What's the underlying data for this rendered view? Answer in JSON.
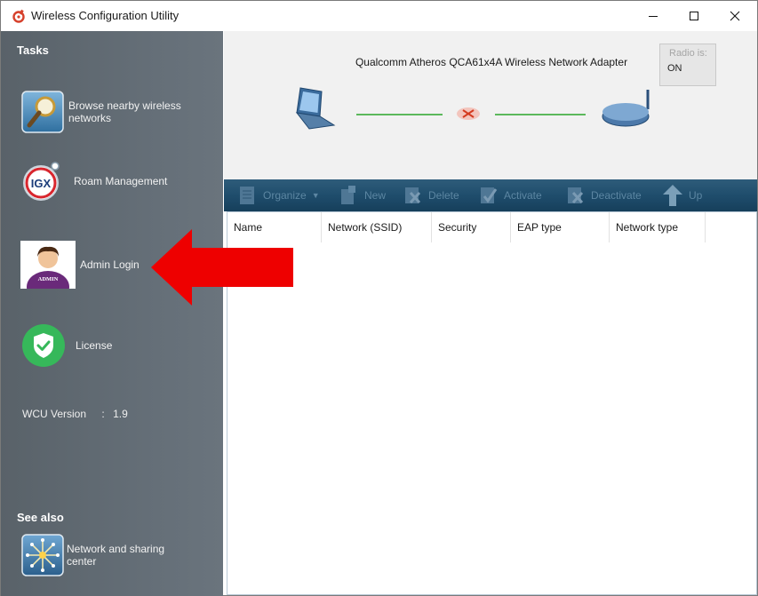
{
  "window": {
    "title": "Wireless Configuration Utility"
  },
  "sidebar": {
    "tasks_heading": "Tasks",
    "tasks": [
      {
        "label_line1": "Browse nearby wireless",
        "label_line2": "networks",
        "icon": "magnifier-icon"
      },
      {
        "label_line1": "Roam Management",
        "label_line2": "",
        "icon": "igx-logo-icon"
      },
      {
        "label_line1": "Admin Login",
        "label_line2": "",
        "icon": "admin-avatar-icon",
        "avatar_badge": "ADMIN"
      },
      {
        "label_line1": "License",
        "label_line2": "",
        "icon": "shield-check-icon"
      }
    ],
    "version_label": "WCU Version",
    "version_sep": ":",
    "version_value": "1.9",
    "see_also_heading": "See also",
    "see_also": [
      {
        "label_line1": "Network and sharing",
        "label_line2": "center",
        "icon": "network-hub-icon"
      }
    ],
    "igx_text": "IGX"
  },
  "banner": {
    "adapter_name": "Qualcomm Atheros QCA61x4A Wireless Network Adapter",
    "radio_label": "Radio is:",
    "radio_value": "ON"
  },
  "toolbar": {
    "organize": "Organize",
    "new": "New",
    "delete": "Delete",
    "activate": "Activate",
    "deactivate": "Deactivate",
    "up": "Up"
  },
  "table": {
    "columns": [
      "Name",
      "Network (SSID)",
      "Security",
      "EAP type",
      "Network type"
    ]
  },
  "colors": {
    "sidebar": "#606a73",
    "toolbar": "#1f4d6c",
    "arrow": "#ee0000",
    "link_line": "#5cb85c"
  }
}
